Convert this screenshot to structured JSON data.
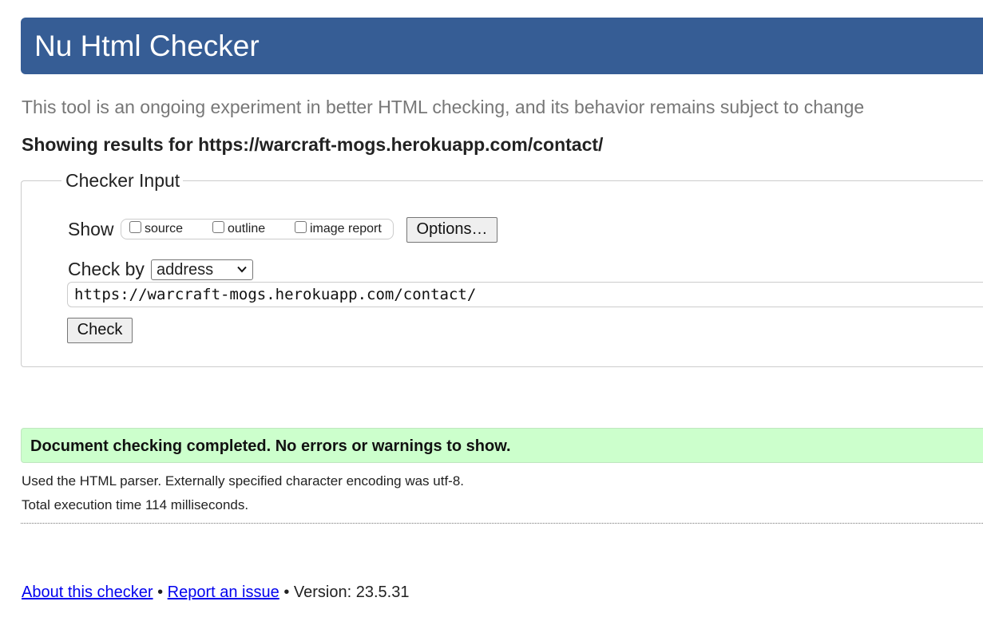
{
  "header": {
    "title": "Nu Html Checker"
  },
  "tagline": "This tool is an ongoing experiment in better HTML checking, and its behavior remains subject to change",
  "results_for": "Showing results for https://warcraft-mogs.herokuapp.com/contact/",
  "checker_input": {
    "legend": "Checker Input",
    "show_label": "Show",
    "show_options": [
      {
        "label": "source",
        "checked": false
      },
      {
        "label": "outline",
        "checked": false
      },
      {
        "label": "image report",
        "checked": false
      }
    ],
    "options_button": "Options…",
    "check_by_label": "Check by",
    "check_by_selected": "address",
    "url_value": "https://warcraft-mogs.herokuapp.com/contact/",
    "check_button": "Check"
  },
  "result": {
    "status": "Document checking completed. No errors or warnings to show.",
    "parser_info": "Used the HTML parser. Externally specified character encoding was utf-8.",
    "execution_time": "Total execution time 114 milliseconds."
  },
  "footer": {
    "about_link": "About this checker",
    "separator": "•",
    "report_link": "Report an issue",
    "version_text": "Version: 23.5.31"
  },
  "colors": {
    "header_bg": "#365d95",
    "success_bg": "#ccffcc",
    "link": "#0000ee"
  }
}
